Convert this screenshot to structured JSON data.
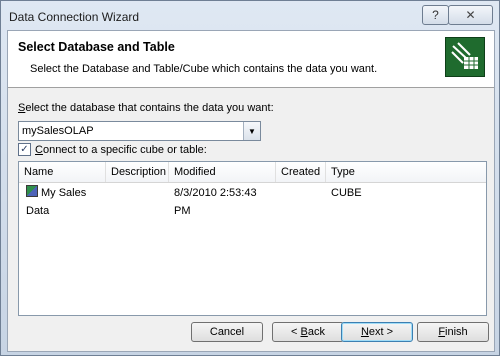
{
  "window": {
    "title": "Data Connection Wizard",
    "help": "?",
    "close": "✕"
  },
  "header": {
    "title": "Select Database and Table",
    "subtitle": "Select the Database and Table/Cube which contains the data you want."
  },
  "database": {
    "label_prefix": "",
    "label_accel": "S",
    "label_rest": "elect the database that contains the data you want:",
    "selected": "mySalesOLAP",
    "dropdown_glyph": "▼"
  },
  "connect_checkbox": {
    "checked": true,
    "check_glyph": "✓",
    "label_accel": "C",
    "label_rest": "onnect to a specific cube or table:"
  },
  "table": {
    "columns": [
      "Name",
      "Description",
      "Modified",
      "Created",
      "Type"
    ],
    "rows": [
      {
        "name": "My Sales Data",
        "description": "",
        "modified": "8/3/2010 2:53:43 PM",
        "created": "",
        "type": "CUBE"
      }
    ]
  },
  "buttons": {
    "cancel": "Cancel",
    "back_prefix": "< ",
    "back_accel": "B",
    "back_rest": "ack",
    "next_accel": "N",
    "next_rest": "ext >",
    "finish_accel": "F",
    "finish_rest": "inish"
  }
}
